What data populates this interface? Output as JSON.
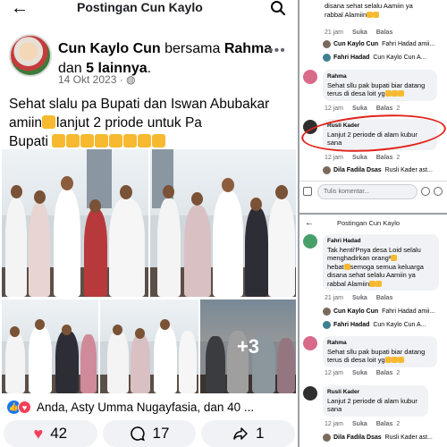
{
  "left": {
    "topbar": {
      "back_icon": "arrow-left-icon",
      "title": "Postingan Cun Kaylo",
      "search_icon": "search-icon"
    },
    "post": {
      "author": "Cun Kaylo Cun",
      "with_word": "bersama",
      "tagged": "Rahma",
      "and_word": "dan",
      "others": "5 lainnya",
      "date": "14 Okt 2023",
      "privacy_sep": "·",
      "privacy_icon": "globe-icon",
      "more_icon": "more-dots-icon",
      "text_line1": "Sehat slalu pa Bupati dan Iswan Abubakar",
      "text_line2": "amiin",
      "text_line2b": "lanjut 2 priode untuk Pa",
      "text_line3": "Bupati",
      "photo_more": "+3"
    },
    "reactions": {
      "summary": "Anda, Asty Umma Nugayfasia, dan 40 ..."
    },
    "actions": {
      "reactions_count": "42",
      "comments_count": "17",
      "shares_count": "1"
    }
  },
  "right": {
    "top": {
      "line1": "disana sehat selalu Aamiin ya",
      "line2": "rabbal Alamiin",
      "meta1_time": "21 jam",
      "meta1_like": "Suka",
      "meta1_reply": "Balas",
      "reply1_author": "Cun Kaylo Cun",
      "reply1_text": "Fahri Hadad amii...",
      "reply2_author": "Fahri Hadad",
      "reply2_text": "Cun Kaylo Cun A...",
      "c2_name": "Rahma",
      "c2_line1": "Sehat sllu pak bupati biar datang",
      "c2_line2": "terus di desa loit yg",
      "meta2_time": "12 jam",
      "meta2_like": "Suka",
      "meta2_reply": "Balas",
      "meta2_count": "2",
      "c3_name": "Rusli Kader",
      "c3_line1": "Lanjut 2 periode di alam kubur",
      "c3_line2": "sana",
      "meta3_time": "12 jam",
      "meta3_like": "Suka",
      "meta3_reply": "Balas",
      "meta3_count": "2",
      "reply3_author": "Dila Fadila Dsas",
      "reply3_text": "Rusli Kader ast...",
      "compose_placeholder": "Tulis komentar..."
    },
    "bottom": {
      "title": "Postingan Cun Kaylo",
      "c1_name": "Fahri Hadad",
      "c1_line1": "Tak henti'Pnya desa Loid selalu",
      "c1_line2": "menghadirkan orang²",
      "c1_line3": "hebat",
      "c1_line3b": "semoga semua keluarga",
      "c1_line4": "disana sehat selalu Aamiin ya",
      "c1_line5": "rabbal Alamiin",
      "meta1_time": "21 jam",
      "meta1_like": "Suka",
      "meta1_reply": "Balas",
      "reply1_author": "Cun Kaylo Cun",
      "reply1_text": "Fahri Hadad amii...",
      "reply2_author": "Fahri Hadad",
      "reply2_text": "Cun Kaylo Cun A...",
      "c2_name": "Rahma",
      "c2_line1": "Sehat sllu pak bupati biar datang",
      "c2_line2": "terus di desa loit yg",
      "meta2_time": "12 jam",
      "meta2_like": "Suka",
      "meta2_reply": "Balas",
      "meta2_count": "2",
      "c3_name": "Rusli Kader",
      "c3_line1": "Lanjut 2 periode di alam kubur",
      "c3_line2": "sana",
      "meta3_time": "12 jam",
      "meta3_like": "Suka",
      "meta3_reply": "Balas",
      "meta3_count": "2",
      "reply3_author": "Dila Fadila Dsas",
      "reply3_text": "Rusli Kader ast..."
    }
  },
  "colors": {
    "link_blue": "#1877f2",
    "love_red": "#f33e58",
    "annotation_red": "#e1231b",
    "bubble_gray": "#f0f2f5"
  }
}
